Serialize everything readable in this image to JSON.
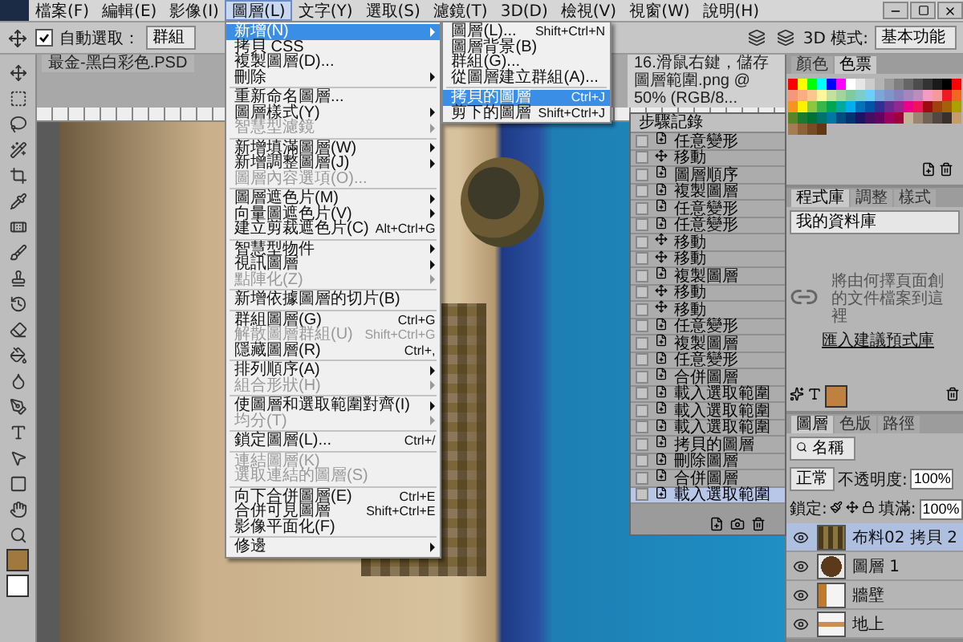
{
  "menubar": {
    "items": [
      {
        "label": "檔案(F)",
        "selected": false
      },
      {
        "label": "編輯(E)",
        "selected": false
      },
      {
        "label": "影像(I)",
        "selected": false
      },
      {
        "label": "圖層(L)",
        "selected": true
      },
      {
        "label": "文字(Y)",
        "selected": false
      },
      {
        "label": "選取(S)",
        "selected": false
      },
      {
        "label": "濾鏡(T)",
        "selected": false
      },
      {
        "label": "3D(D)",
        "selected": false
      },
      {
        "label": "檢視(V)",
        "selected": false
      },
      {
        "label": "視窗(W)",
        "selected": false
      },
      {
        "label": "說明(H)",
        "selected": false
      }
    ]
  },
  "options_bar": {
    "auto_select": {
      "label": "自動選取：",
      "checked": true
    },
    "target": "群組",
    "mode_label": "3D 模式:",
    "workspace": "基本功能"
  },
  "document_tabs": [
    {
      "title": "最金-黑白彩色.PSD",
      "selected": false
    },
    {
      "title": "16.滑鼠右鍵，儲存圖層範圍.png @ 50% (RGB/8...",
      "selected": true
    }
  ],
  "layer_menu": {
    "items": [
      {
        "kind": "item",
        "label": "新增(N)",
        "submenu": true,
        "disabled": false,
        "selected": true
      },
      {
        "kind": "item",
        "label": "拷貝 CSS",
        "submenu": false,
        "disabled": false,
        "selected": false
      },
      {
        "kind": "item",
        "label": "複製圖層(D)...",
        "submenu": false,
        "disabled": false,
        "selected": false
      },
      {
        "kind": "item",
        "label": "刪除",
        "submenu": true,
        "disabled": false,
        "selected": false
      },
      {
        "kind": "separator"
      },
      {
        "kind": "item",
        "label": "重新命名圖層...",
        "submenu": false,
        "disabled": false,
        "selected": false
      },
      {
        "kind": "item",
        "label": "圖層樣式(Y)",
        "submenu": true,
        "disabled": false,
        "selected": false
      },
      {
        "kind": "item",
        "label": "智慧型濾鏡",
        "submenu": true,
        "disabled": true,
        "selected": false
      },
      {
        "kind": "separator"
      },
      {
        "kind": "item",
        "label": "新增填滿圖層(W)",
        "submenu": true,
        "disabled": false,
        "selected": false
      },
      {
        "kind": "item",
        "label": "新增調整圖層(J)",
        "submenu": true,
        "disabled": false,
        "selected": false
      },
      {
        "kind": "item",
        "label": "圖層內容選項(O)...",
        "submenu": false,
        "disabled": true,
        "selected": false
      },
      {
        "kind": "separator"
      },
      {
        "kind": "item",
        "label": "圖層遮色片(M)",
        "submenu": true,
        "disabled": false,
        "selected": false
      },
      {
        "kind": "item",
        "label": "向量圖遮色片(V)",
        "submenu": true,
        "disabled": false,
        "selected": false
      },
      {
        "kind": "item",
        "label": "建立剪裁遮色片(C)",
        "shortcut": "Alt+Ctrl+G",
        "submenu": false,
        "disabled": false,
        "selected": false
      },
      {
        "kind": "separator"
      },
      {
        "kind": "item",
        "label": "智慧型物件",
        "submenu": true,
        "disabled": false,
        "selected": false
      },
      {
        "kind": "item",
        "label": "視訊圖層",
        "submenu": true,
        "disabled": false,
        "selected": false
      },
      {
        "kind": "item",
        "label": "點陣化(Z)",
        "submenu": true,
        "disabled": true,
        "selected": false
      },
      {
        "kind": "separator"
      },
      {
        "kind": "item",
        "label": "新增依據圖層的切片(B)",
        "submenu": false,
        "disabled": false,
        "selected": false
      },
      {
        "kind": "separator"
      },
      {
        "kind": "item",
        "label": "群組圖層(G)",
        "shortcut": "Ctrl+G",
        "submenu": false,
        "disabled": false,
        "selected": false
      },
      {
        "kind": "item",
        "label": "解散圖層群組(U)",
        "shortcut": "Shift+Ctrl+G",
        "submenu": false,
        "disabled": true,
        "selected": false
      },
      {
        "kind": "item",
        "label": "隱藏圖層(R)",
        "shortcut": "Ctrl+,",
        "submenu": false,
        "disabled": false,
        "selected": false
      },
      {
        "kind": "separator"
      },
      {
        "kind": "item",
        "label": "排列順序(A)",
        "submenu": true,
        "disabled": false,
        "selected": false
      },
      {
        "kind": "item",
        "label": "組合形狀(H)",
        "submenu": true,
        "disabled": true,
        "selected": false
      },
      {
        "kind": "separator"
      },
      {
        "kind": "item",
        "label": "使圖層和選取範圍對齊(I)",
        "submenu": true,
        "disabled": false,
        "selected": false
      },
      {
        "kind": "item",
        "label": "均分(T)",
        "submenu": true,
        "disabled": true,
        "selected": false
      },
      {
        "kind": "separator"
      },
      {
        "kind": "item",
        "label": "鎖定圖層(L)...",
        "shortcut": "Ctrl+/",
        "submenu": false,
        "disabled": false,
        "selected": false
      },
      {
        "kind": "separator"
      },
      {
        "kind": "item",
        "label": "連結圖層(K)",
        "submenu": false,
        "disabled": true,
        "selected": false
      },
      {
        "kind": "item",
        "label": "選取連結的圖層(S)",
        "submenu": false,
        "disabled": true,
        "selected": false
      },
      {
        "kind": "separator"
      },
      {
        "kind": "item",
        "label": "向下合併圖層(E)",
        "shortcut": "Ctrl+E",
        "submenu": false,
        "disabled": false,
        "selected": false
      },
      {
        "kind": "item",
        "label": "合併可見圖層",
        "shortcut": "Shift+Ctrl+E",
        "submenu": false,
        "disabled": false,
        "selected": false
      },
      {
        "kind": "item",
        "label": "影像平面化(F)",
        "submenu": false,
        "disabled": false,
        "selected": false
      },
      {
        "kind": "separator"
      },
      {
        "kind": "item",
        "label": "修邊",
        "submenu": true,
        "disabled": false,
        "selected": false
      }
    ]
  },
  "new_submenu": {
    "items": [
      {
        "kind": "item",
        "label": "圖層(L)...",
        "shortcut": "Shift+Ctrl+N",
        "submenu": false,
        "disabled": false,
        "selected": false
      },
      {
        "kind": "item",
        "label": "圖層背景(B)",
        "submenu": false,
        "disabled": false,
        "selected": false
      },
      {
        "kind": "item",
        "label": "群組(G)...",
        "submenu": false,
        "disabled": false,
        "selected": false
      },
      {
        "kind": "item",
        "label": "從圖層建立群組(A)...",
        "submenu": false,
        "disabled": false,
        "selected": false
      },
      {
        "kind": "separator"
      },
      {
        "kind": "item",
        "label": "拷貝的圖層",
        "shortcut": "Ctrl+J",
        "submenu": false,
        "disabled": false,
        "selected": true
      },
      {
        "kind": "item",
        "label": "剪下的圖層",
        "shortcut": "Shift+Ctrl+J",
        "submenu": false,
        "disabled": false,
        "selected": false
      }
    ]
  },
  "history": {
    "title": "步驟記錄",
    "items": [
      {
        "label": "任意變形",
        "kind": "document",
        "selected": false
      },
      {
        "label": "移動",
        "kind": "move",
        "selected": false
      },
      {
        "label": "圖層順序",
        "kind": "document",
        "selected": false
      },
      {
        "label": "複製圖層",
        "kind": "document",
        "selected": false
      },
      {
        "label": "任意變形",
        "kind": "document",
        "selected": false
      },
      {
        "label": "任意變形",
        "kind": "document",
        "selected": false
      },
      {
        "label": "移動",
        "kind": "move",
        "selected": false
      },
      {
        "label": "移動",
        "kind": "move",
        "selected": false
      },
      {
        "label": "複製圖層",
        "kind": "document",
        "selected": false
      },
      {
        "label": "移動",
        "kind": "move",
        "selected": false
      },
      {
        "label": "移動",
        "kind": "move",
        "selected": false
      },
      {
        "label": "任意變形",
        "kind": "document",
        "selected": false
      },
      {
        "label": "複製圖層",
        "kind": "document",
        "selected": false
      },
      {
        "label": "任意變形",
        "kind": "document",
        "selected": false
      },
      {
        "label": "合併圖層",
        "kind": "document",
        "selected": false
      },
      {
        "label": "載入選取範圍",
        "kind": "document",
        "selected": false
      },
      {
        "label": "載入選取範圍",
        "kind": "document",
        "selected": false
      },
      {
        "label": "載入選取範圍",
        "kind": "document",
        "selected": false
      },
      {
        "label": "拷貝的圖層",
        "kind": "document",
        "selected": false
      },
      {
        "label": "刪除圖層",
        "kind": "document",
        "selected": false
      },
      {
        "label": "合併圖層",
        "kind": "document",
        "selected": false
      },
      {
        "label": "載入選取範圍",
        "kind": "document",
        "selected": true
      }
    ]
  },
  "swatches_panel": {
    "tabs": [
      {
        "label": "顏色",
        "selected": false
      },
      {
        "label": "色票",
        "selected": true
      }
    ]
  },
  "library_panel": {
    "tabs": [
      {
        "label": "程式庫",
        "selected": true
      },
      {
        "label": "調整",
        "selected": false
      },
      {
        "label": "樣式",
        "selected": false
      }
    ],
    "library": "我的資料庫",
    "message": "將由何擇頁面創的文件檔案到這裡",
    "link": "匯入建議預式庫"
  },
  "layers_panel": {
    "tabs": [
      {
        "label": "圖層",
        "selected": true
      },
      {
        "label": "色版",
        "selected": false
      },
      {
        "label": "路徑",
        "selected": false
      }
    ],
    "filter": "名稱",
    "blend_mode": "正常",
    "opacity_label": "不透明度:",
    "opacity": "100%",
    "lock_label": "鎖定:",
    "fill_label": "填滿:",
    "fill": "100%",
    "layers": [
      {
        "name": "布料02 拷貝 2",
        "kind": "fabric",
        "visible": true,
        "selected": true
      },
      {
        "name": "圖層 1",
        "kind": "hat",
        "visible": true,
        "selected": false
      },
      {
        "name": "牆壁",
        "kind": "wall",
        "visible": true,
        "selected": false
      },
      {
        "name": "地上",
        "kind": "floor",
        "visible": true,
        "selected": false
      }
    ]
  }
}
